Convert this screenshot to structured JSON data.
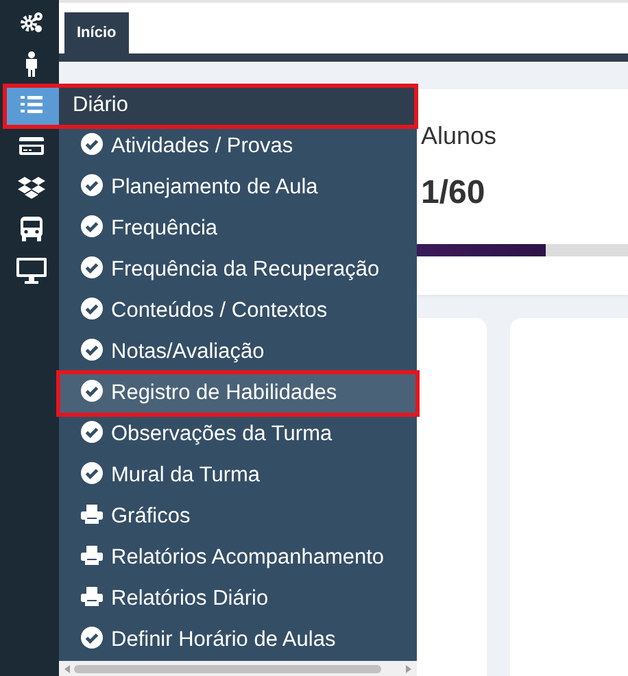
{
  "rail": [
    {
      "selected": false
    },
    {
      "selected": false
    },
    {
      "selected": true
    },
    {
      "selected": false
    },
    {
      "selected": false
    },
    {
      "selected": false
    },
    {
      "selected": false
    }
  ],
  "tabs": [
    {
      "label": "Início",
      "selected": true
    }
  ],
  "card": {
    "title": "Alunos",
    "value": "1/60",
    "level": 0.85
  },
  "menu": {
    "title": "Diário",
    "highlighted": true,
    "items": [
      {
        "label": "Atividades / Provas",
        "kind": "task",
        "selected": false,
        "highlighted": false
      },
      {
        "label": "Planejamento de Aula",
        "kind": "task",
        "selected": false,
        "highlighted": false
      },
      {
        "label": "Frequência",
        "kind": "task",
        "selected": false,
        "highlighted": false
      },
      {
        "label": "Frequência da Recuperação",
        "kind": "task",
        "selected": false,
        "highlighted": false
      },
      {
        "label": "Conteúdos / Contextos",
        "kind": "task",
        "selected": false,
        "highlighted": false
      },
      {
        "label": "Notas/Avaliação",
        "kind": "task",
        "selected": false,
        "highlighted": false
      },
      {
        "label": "Registro de Habilidades",
        "kind": "task",
        "selected": true,
        "highlighted": true
      },
      {
        "label": "Observações da Turma",
        "kind": "task",
        "selected": false,
        "highlighted": false
      },
      {
        "label": "Mural da Turma",
        "kind": "task",
        "selected": false,
        "highlighted": false
      },
      {
        "label": "Gráficos",
        "kind": "report",
        "selected": false,
        "highlighted": false
      },
      {
        "label": "Relatórios Acompanhamento",
        "kind": "report",
        "selected": false,
        "highlighted": false
      },
      {
        "label": "Relatórios Diário",
        "kind": "report",
        "selected": false,
        "highlighted": false
      },
      {
        "label": "Definir Horário de Aulas",
        "kind": "task",
        "selected": false,
        "highlighted": false
      }
    ]
  }
}
